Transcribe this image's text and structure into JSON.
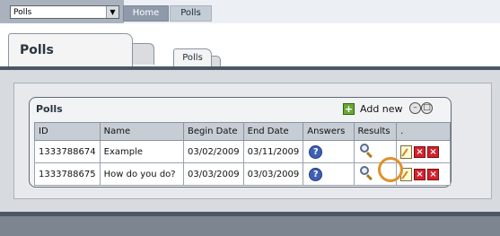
{
  "topbar": {
    "module_select": "Polls",
    "nav": [
      {
        "label": "Home"
      },
      {
        "label": "Polls"
      }
    ]
  },
  "tabs": {
    "main_title": "Polls",
    "sub_tab": "Polls"
  },
  "panel": {
    "title": "Polls",
    "add_new_label": "Add new",
    "columns": [
      "ID",
      "Name",
      "Begin Date",
      "End Date",
      "Answers",
      "Results",
      "."
    ],
    "rows": [
      {
        "id": "1333788674",
        "name": "Example",
        "begin": "03/02/2009",
        "end": "03/11/2009"
      },
      {
        "id": "1333788675",
        "name": "How do you do?",
        "begin": "03/03/2009",
        "end": "03/03/2009"
      }
    ]
  },
  "icons": {
    "answers": "help-question-icon",
    "results": "magnifier-icon",
    "edit": "edit-icon",
    "delete": "delete-icon"
  },
  "colors": {
    "highlight_ring": "#e0902c",
    "delete_red": "#d4222a",
    "header_gray": "#c7cdd4"
  }
}
